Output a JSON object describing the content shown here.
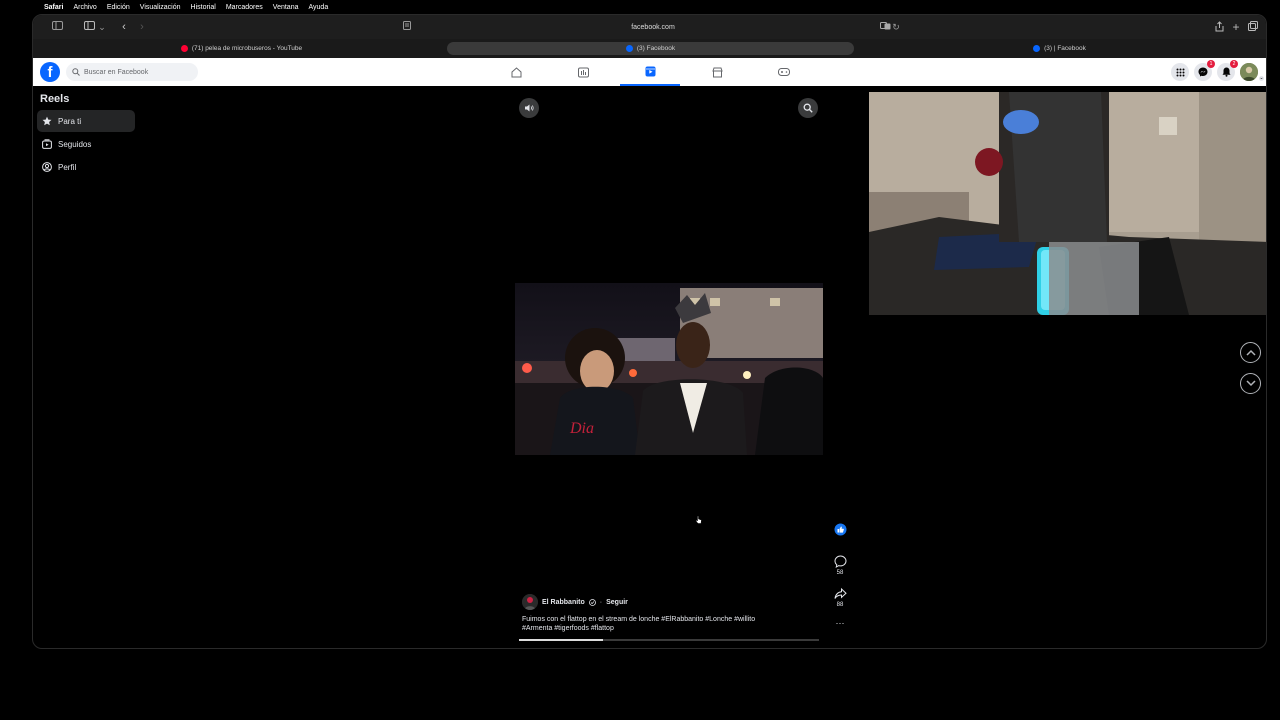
{
  "menubar": {
    "items": [
      "Safari",
      "Archivo",
      "Edición",
      "Visualización",
      "Historial",
      "Marcadores",
      "Ventana",
      "Ayuda"
    ]
  },
  "browser": {
    "address": "facebook.com",
    "tabs": [
      {
        "label": "(71) pelea de microbuseros - YouTube",
        "favicon_color": "#ff0033",
        "active": false
      },
      {
        "label": "(3) Facebook",
        "favicon_color": "#0866ff",
        "active": true
      },
      {
        "label": "(3) | Facebook",
        "favicon_color": "#0866ff",
        "active": false
      }
    ]
  },
  "facebook": {
    "search_placeholder": "Buscar en Facebook",
    "nav_icons": [
      "home-icon",
      "video-icon",
      "reels-icon",
      "marketplace-icon",
      "gaming-icon"
    ],
    "active_nav": "reels-icon",
    "messenger_badge": "1",
    "notification_badge": "2"
  },
  "sidebar": {
    "title": "Reels",
    "items": [
      {
        "label": "Para ti",
        "icon": "star-icon",
        "active": true
      },
      {
        "label": "Seguidos",
        "icon": "following-icon",
        "active": false
      },
      {
        "label": "Perfil",
        "icon": "profile-icon",
        "active": false
      }
    ]
  },
  "reel": {
    "author": "El Rabbanito",
    "follow_label": "Seguir",
    "separator": "·",
    "caption_line1": "Fuimos con el flattop en el stream de lonche  #ElRabbanito  #Lonche #willito",
    "caption_line2": "#Armenta #tigerfoods #flattop",
    "comments": "58",
    "shares": "88",
    "progress": 0.28
  },
  "colors": {
    "accent": "#0866ff",
    "badge": "#e41e3f"
  }
}
